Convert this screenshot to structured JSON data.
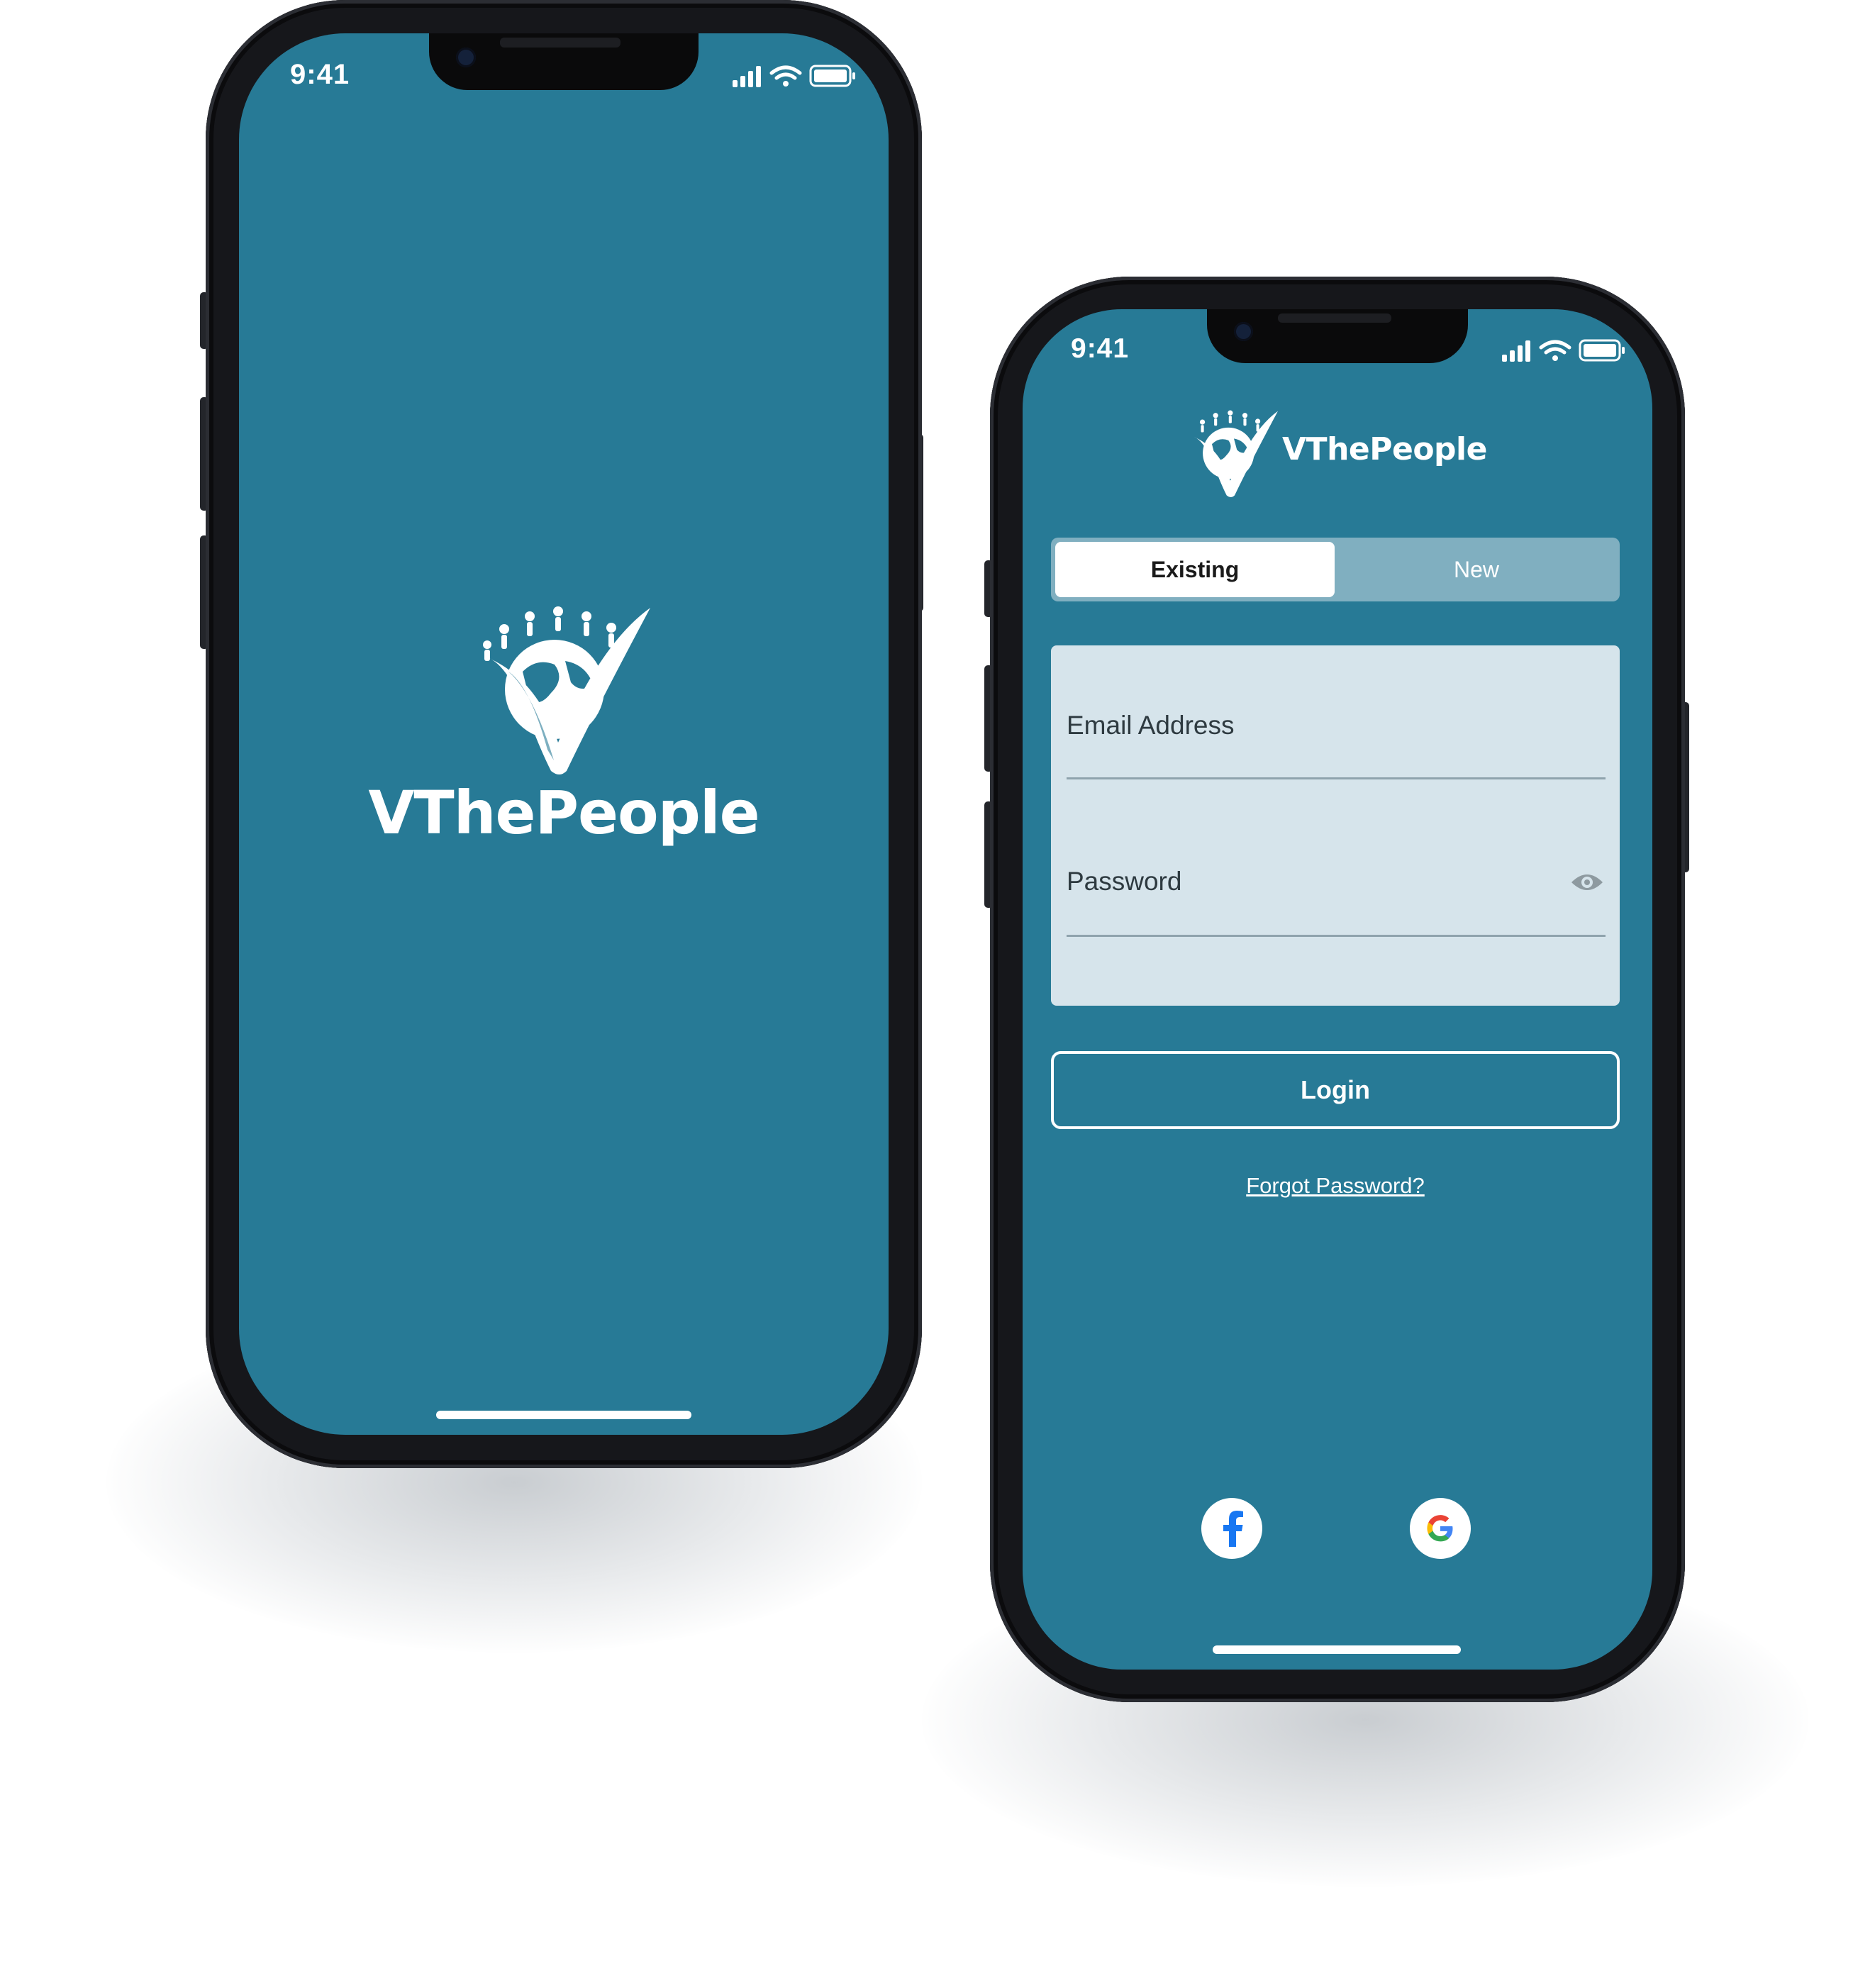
{
  "splash": {
    "time": "9:41",
    "brand": "VThePeople"
  },
  "login": {
    "time": "9:41",
    "brand": "VThePeople",
    "tabs": [
      {
        "label": "Existing",
        "active": true
      },
      {
        "label": "New",
        "active": false
      }
    ],
    "email": {
      "placeholder": "Email Address",
      "value": ""
    },
    "password": {
      "placeholder": "Password",
      "value": ""
    },
    "login_label": "Login",
    "forgot_label": "Forgot Password?",
    "social": [
      "facebook-icon",
      "google-icon"
    ]
  },
  "colors": {
    "brand_bg": "#277a96",
    "card": "#d6e4eb",
    "segment_track": "#80afc0"
  }
}
